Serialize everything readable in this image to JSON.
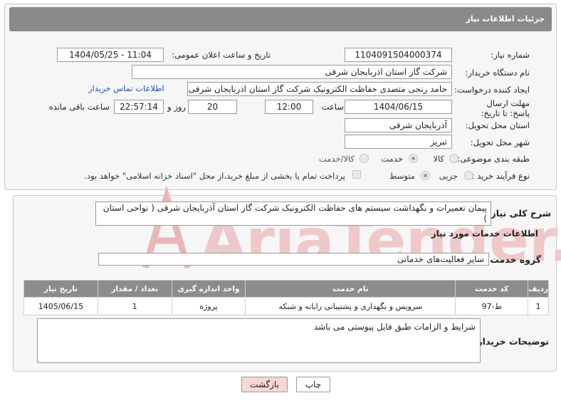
{
  "header": {
    "title": "جزئیات اطلاعات نیاز"
  },
  "fields": {
    "need_number_label": "شماره نیاز:",
    "need_number": "1104091504000374",
    "announce_label": "تاریخ و ساعت اعلان عمومی:",
    "announce_value": "1404/05/25 - 11:04",
    "buyer_org_label": "نام دستگاه خریدار:",
    "buyer_org": "شرکت گاز استان اذربایجان شرقی",
    "requester_label": "ایجاد کننده درخواست:",
    "requester": "حامد رنجی متصدی حفاظت الکترونیک  شرکت گاز استان اذربایجان شرقی",
    "contact_link": "اطلاعات تماس خریدار",
    "deadline_label": "مهلت ارسال پاسخ: تا تاریخ:",
    "deadline_date": "1404/06/15",
    "time_label": "ساعت",
    "deadline_time": "12:00",
    "days_value": "20",
    "days_label": "روز و",
    "remaining_time": "22:57:14",
    "remaining_label": "ساعت باقی مانده",
    "province_label": "استان محل تحویل:",
    "province": "آذربایجان شرقی",
    "city_label": "شهر محل تحویل:",
    "city": "تبریز",
    "category_label": "طبقه بندی موضوعی:",
    "category_options": [
      "کالا",
      "خدمت",
      "کالا/خدمت"
    ],
    "process_label": "نوع فرآیند خرید :",
    "process_options": [
      "جزیی",
      "متوسط"
    ],
    "payment_note": "پرداخت تمام یا بخشی از مبلغ خرید،از محل \"اسناد خزانه اسلامی\" خواهد بود."
  },
  "summary": {
    "label": "شرح کلی نیاز:",
    "text": "پیمان تعمیرات و نگهداشت سیستم های حفاظت الکترونیک شرکت گاز استان آذربایجان شرقی ( نواحی استان )"
  },
  "services": {
    "section_title": "اطلاعات خدمات مورد نیاز",
    "group_label": "گروه خدمت:",
    "group_value": "سایر فعالیت‌های خدماتی",
    "columns": [
      "ردیف",
      "کد خدمت",
      "نام خدمت",
      "واحد اندازه گیری",
      "تعداد / مقدار",
      "تاریخ نیاز"
    ],
    "rows": [
      {
        "row": "1",
        "code": "ط-97",
        "name": "سرویس و نگهداری و پشتیبانی رایانه و شبکه",
        "unit": "پروژه",
        "qty": "1",
        "date": "1405/06/15"
      }
    ]
  },
  "notes": {
    "label": "توضیحات خریدار:",
    "text": "شرایط و الزامات طبق فایل پیوستی می باشد"
  },
  "buttons": {
    "print": "چاپ",
    "back": "بازگشت"
  },
  "watermark": {
    "text": "AriaTender.neT"
  },
  "colors": {
    "header_bg": "#8a8a8a",
    "link": "#1a56b8",
    "back_button_bg": "#f7d6d6",
    "watermark": "#e9b7b7"
  }
}
